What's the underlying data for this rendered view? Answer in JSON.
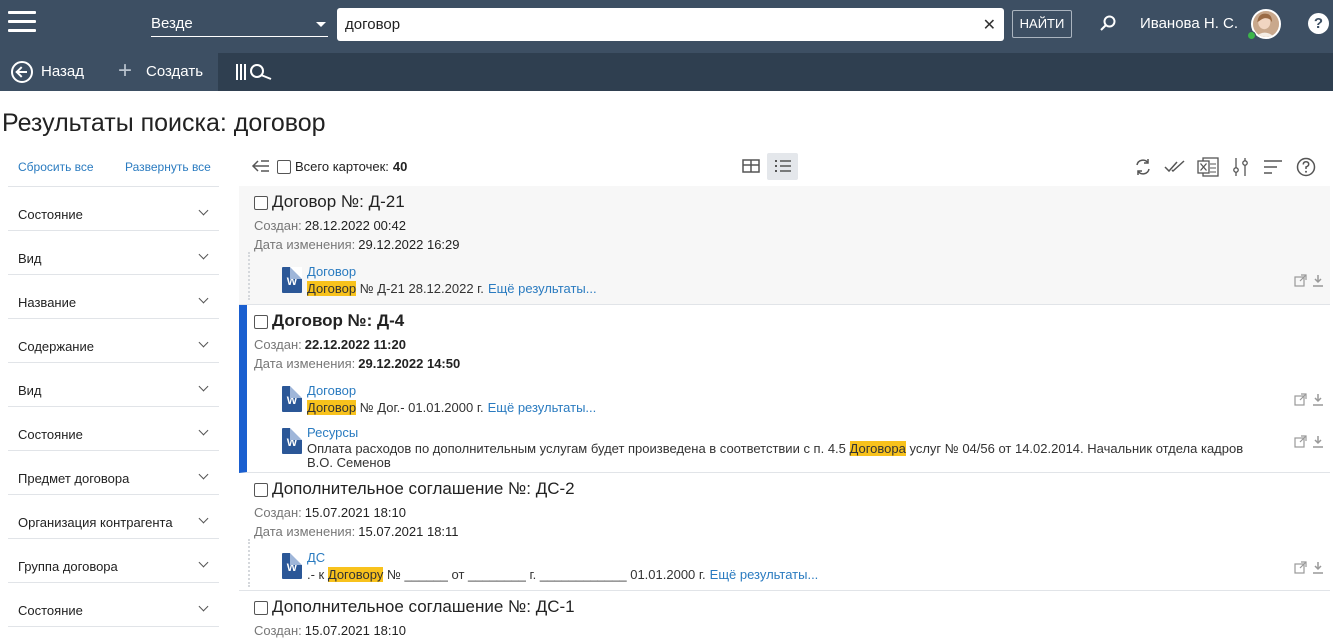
{
  "header": {
    "scope_value": "Везде",
    "search_value": "договор",
    "find_label": "НАЙТИ",
    "user_name": "Иванова Н. С.",
    "help_glyph": "?"
  },
  "actionbar": {
    "back_label": "Назад",
    "create_label": "Создать"
  },
  "page": {
    "title": "Результаты поиска: договор"
  },
  "sidebar": {
    "reset_label": "Сбросить все",
    "expand_label": "Развернуть все",
    "filters": [
      "Состояние",
      "Вид",
      "Название",
      "Содержание",
      "Вид",
      "Состояние",
      "Предмет договора",
      "Организация контрагента",
      "Группа договора",
      "Состояние"
    ]
  },
  "toolbar": {
    "total_label": "Всего карточек:",
    "total_count": "40"
  },
  "results": [
    {
      "title": "Договор №: Д-21",
      "created_label": "Создан:",
      "created": "28.12.2022 00:42",
      "modified_label": "Дата изменения:",
      "modified": "29.12.2022 16:29",
      "files": [
        {
          "name": "Договор",
          "hl": "Договор",
          "text": "№ Д-21 28.12.2022 г.",
          "more": "Ещё результаты..."
        }
      ]
    },
    {
      "title": "Договор №: Д-4",
      "created_label": "Создан:",
      "created": "22.12.2022 11:20",
      "modified_label": "Дата изменения:",
      "modified": "29.12.2022 14:50",
      "files": [
        {
          "name": "Договор",
          "hl": "Договор",
          "text": "№ Дог.- 01.01.2000 г.",
          "more": "Ещё результаты..."
        },
        {
          "name": "Ресурсы",
          "pre": "Оплата расходов по дополнительным услугам будет произведена в соответствии с п. 4.5",
          "hl": "Договора",
          "text": "услуг № 04/56 от 14.02.2014.     Начальник отдела кадров В.О. Семенов"
        }
      ]
    },
    {
      "title": "Дополнительное соглашение №: ДС-2",
      "created_label": "Создан:",
      "created": "15.07.2021 18:10",
      "modified_label": "Дата изменения:",
      "modified": "15.07.2021 18:11",
      "files": [
        {
          "name": "ДС",
          "pre": ".- к",
          "hl": "Договору",
          "text": "№ ______ от ________ г. ____________ 01.01.2000 г.",
          "more": "Ещё результаты..."
        }
      ]
    },
    {
      "title": "Дополнительное соглашение №: ДС-1",
      "created_label": "Создан:",
      "created": "15.07.2021 18:10"
    }
  ],
  "icons": {
    "word": "W"
  },
  "colors": {
    "topbar": "#3d4f63",
    "actionbar": "#2f3f50",
    "accent_link": "#2a7bc0",
    "highlight": "#f8c21c",
    "selected_marker": "#1a5fd0"
  }
}
